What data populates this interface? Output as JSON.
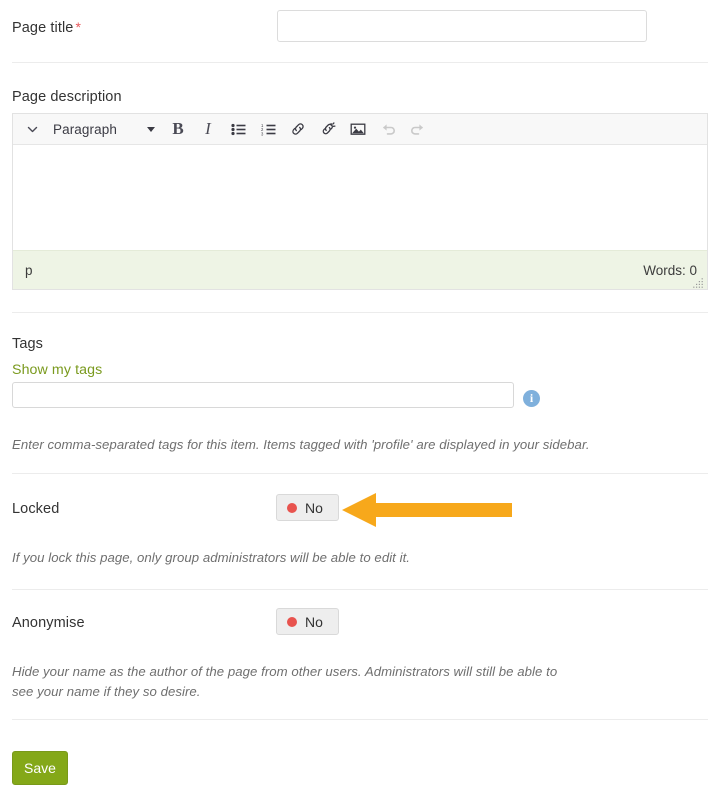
{
  "form": {
    "title_field": {
      "label": "Page title",
      "required_marker": "*",
      "value": "",
      "placeholder": ""
    },
    "description_field": {
      "label": "Page description",
      "content": "",
      "toolbar": {
        "expand_icon": "chevron-down-icon",
        "format_select": "Paragraph",
        "bold": "B",
        "italic": "I",
        "bullet_list": "bullet-list-icon",
        "numbered_list": "numbered-list-icon",
        "link": "link-icon",
        "unlink": "unlink-icon",
        "image": "image-icon",
        "undo": "undo-icon",
        "redo": "redo-icon"
      },
      "statusbar": {
        "path": "p",
        "word_count": "Words: 0"
      }
    },
    "tags_field": {
      "label": "Tags",
      "show_my_tags_link": "Show my tags",
      "value": "",
      "placeholder": "",
      "info_icon": "i",
      "help": "Enter comma-separated tags for this item. Items tagged with 'profile' are displayed in your sidebar."
    },
    "locked_field": {
      "label": "Locked",
      "switch_value": "No",
      "help": "If you lock this page, only group administrators will be able to edit it."
    },
    "anonymise_field": {
      "label": "Anonymise",
      "switch_value": "No",
      "help": "Hide your name as the author of the page from other users. Administrators will still be able to see your name if they so desire."
    },
    "save_button": "Save"
  },
  "annotation": {
    "arrow": "left-arrow-annotation"
  },
  "colors": {
    "accent_green": "#84a818",
    "link_green": "#7a9a1e",
    "required_red": "#e8585b",
    "switch_off_dot": "#e8534e",
    "annotation_orange": "#f5a623",
    "info_blue": "#7fb0dc",
    "editor_status_bg": "#eef4e5"
  }
}
